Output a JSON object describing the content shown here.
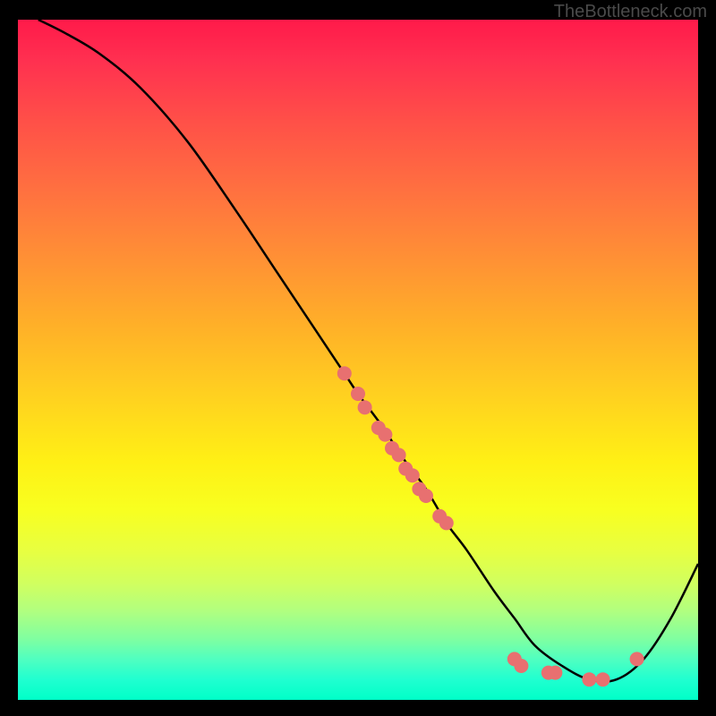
{
  "attribution": "TheBottleneck.com",
  "chart_data": {
    "type": "line",
    "title": "",
    "xlabel": "",
    "ylabel": "",
    "xlim": [
      0,
      100
    ],
    "ylim": [
      0,
      100
    ],
    "series": [
      {
        "name": "curve",
        "x": [
          3,
          7,
          12,
          18,
          25,
          32,
          38,
          44,
          48,
          50,
          53,
          55,
          57,
          60,
          63,
          66,
          70,
          73,
          76,
          80,
          84,
          88,
          92,
          96,
          100
        ],
        "y": [
          100,
          98,
          95,
          90,
          82,
          72,
          63,
          54,
          48,
          45,
          41,
          38,
          35,
          31,
          26,
          22,
          16,
          12,
          8,
          5,
          3,
          3,
          6,
          12,
          20
        ]
      }
    ],
    "dots_on_curve": [
      {
        "x": 48,
        "y": 48
      },
      {
        "x": 50,
        "y": 45
      },
      {
        "x": 51,
        "y": 43
      },
      {
        "x": 53,
        "y": 40
      },
      {
        "x": 54,
        "y": 39
      },
      {
        "x": 55,
        "y": 37
      },
      {
        "x": 56,
        "y": 36
      },
      {
        "x": 57,
        "y": 34
      },
      {
        "x": 58,
        "y": 33
      },
      {
        "x": 59,
        "y": 31
      },
      {
        "x": 60,
        "y": 30
      },
      {
        "x": 62,
        "y": 27
      },
      {
        "x": 63,
        "y": 26
      },
      {
        "x": 73,
        "y": 6
      },
      {
        "x": 74,
        "y": 5
      },
      {
        "x": 78,
        "y": 4
      },
      {
        "x": 79,
        "y": 4
      },
      {
        "x": 84,
        "y": 3
      },
      {
        "x": 86,
        "y": 3
      },
      {
        "x": 91,
        "y": 6
      }
    ],
    "dot_color": "#e87070",
    "curve_color": "#000000"
  }
}
